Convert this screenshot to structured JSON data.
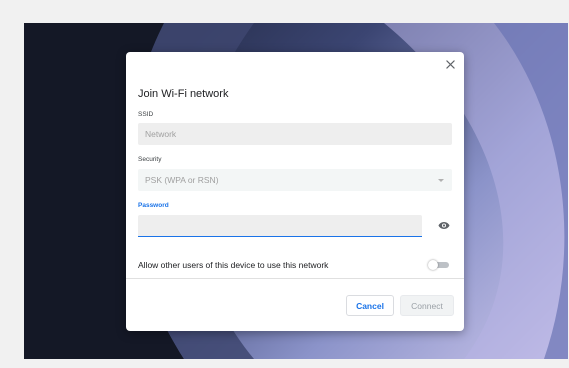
{
  "dialog": {
    "title": "Join Wi-Fi network",
    "close_icon": "close-icon",
    "ssid": {
      "label": "SSID",
      "placeholder": "Network"
    },
    "security": {
      "label": "Security",
      "value": "PSK (WPA or RSN)",
      "icon": "chevron-down-icon"
    },
    "password": {
      "label": "Password",
      "value": "",
      "icon": "eye-icon"
    },
    "share": {
      "label": "Allow other users of this device to use this network",
      "enabled": false
    },
    "buttons": {
      "cancel": "Cancel",
      "connect": "Connect"
    }
  },
  "colors": {
    "accent": "#1a73e8",
    "field_background": "#eeeeee",
    "placeholder": "#a0a0a0"
  }
}
